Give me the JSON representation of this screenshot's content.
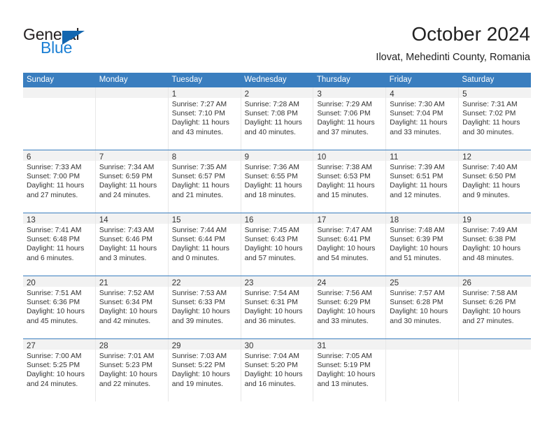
{
  "brand": {
    "name_top": "General",
    "name_bottom": "Blue",
    "accent_color": "#1367b0",
    "text_color": "#231f20"
  },
  "header": {
    "month_title": "October 2024",
    "location": "Ilovat, Mehedinti County, Romania"
  },
  "calendar": {
    "header_bg": "#3a7ebf",
    "daynum_bg": "#f2f2f2",
    "weekdays": [
      "Sunday",
      "Monday",
      "Tuesday",
      "Wednesday",
      "Thursday",
      "Friday",
      "Saturday"
    ],
    "weeks": [
      [
        {
          "day": "",
          "sunrise": "",
          "sunset": "",
          "daylight": ""
        },
        {
          "day": "",
          "sunrise": "",
          "sunset": "",
          "daylight": ""
        },
        {
          "day": "1",
          "sunrise": "Sunrise: 7:27 AM",
          "sunset": "Sunset: 7:10 PM",
          "daylight": "Daylight: 11 hours and 43 minutes."
        },
        {
          "day": "2",
          "sunrise": "Sunrise: 7:28 AM",
          "sunset": "Sunset: 7:08 PM",
          "daylight": "Daylight: 11 hours and 40 minutes."
        },
        {
          "day": "3",
          "sunrise": "Sunrise: 7:29 AM",
          "sunset": "Sunset: 7:06 PM",
          "daylight": "Daylight: 11 hours and 37 minutes."
        },
        {
          "day": "4",
          "sunrise": "Sunrise: 7:30 AM",
          "sunset": "Sunset: 7:04 PM",
          "daylight": "Daylight: 11 hours and 33 minutes."
        },
        {
          "day": "5",
          "sunrise": "Sunrise: 7:31 AM",
          "sunset": "Sunset: 7:02 PM",
          "daylight": "Daylight: 11 hours and 30 minutes."
        }
      ],
      [
        {
          "day": "6",
          "sunrise": "Sunrise: 7:33 AM",
          "sunset": "Sunset: 7:00 PM",
          "daylight": "Daylight: 11 hours and 27 minutes."
        },
        {
          "day": "7",
          "sunrise": "Sunrise: 7:34 AM",
          "sunset": "Sunset: 6:59 PM",
          "daylight": "Daylight: 11 hours and 24 minutes."
        },
        {
          "day": "8",
          "sunrise": "Sunrise: 7:35 AM",
          "sunset": "Sunset: 6:57 PM",
          "daylight": "Daylight: 11 hours and 21 minutes."
        },
        {
          "day": "9",
          "sunrise": "Sunrise: 7:36 AM",
          "sunset": "Sunset: 6:55 PM",
          "daylight": "Daylight: 11 hours and 18 minutes."
        },
        {
          "day": "10",
          "sunrise": "Sunrise: 7:38 AM",
          "sunset": "Sunset: 6:53 PM",
          "daylight": "Daylight: 11 hours and 15 minutes."
        },
        {
          "day": "11",
          "sunrise": "Sunrise: 7:39 AM",
          "sunset": "Sunset: 6:51 PM",
          "daylight": "Daylight: 11 hours and 12 minutes."
        },
        {
          "day": "12",
          "sunrise": "Sunrise: 7:40 AM",
          "sunset": "Sunset: 6:50 PM",
          "daylight": "Daylight: 11 hours and 9 minutes."
        }
      ],
      [
        {
          "day": "13",
          "sunrise": "Sunrise: 7:41 AM",
          "sunset": "Sunset: 6:48 PM",
          "daylight": "Daylight: 11 hours and 6 minutes."
        },
        {
          "day": "14",
          "sunrise": "Sunrise: 7:43 AM",
          "sunset": "Sunset: 6:46 PM",
          "daylight": "Daylight: 11 hours and 3 minutes."
        },
        {
          "day": "15",
          "sunrise": "Sunrise: 7:44 AM",
          "sunset": "Sunset: 6:44 PM",
          "daylight": "Daylight: 11 hours and 0 minutes."
        },
        {
          "day": "16",
          "sunrise": "Sunrise: 7:45 AM",
          "sunset": "Sunset: 6:43 PM",
          "daylight": "Daylight: 10 hours and 57 minutes."
        },
        {
          "day": "17",
          "sunrise": "Sunrise: 7:47 AM",
          "sunset": "Sunset: 6:41 PM",
          "daylight": "Daylight: 10 hours and 54 minutes."
        },
        {
          "day": "18",
          "sunrise": "Sunrise: 7:48 AM",
          "sunset": "Sunset: 6:39 PM",
          "daylight": "Daylight: 10 hours and 51 minutes."
        },
        {
          "day": "19",
          "sunrise": "Sunrise: 7:49 AM",
          "sunset": "Sunset: 6:38 PM",
          "daylight": "Daylight: 10 hours and 48 minutes."
        }
      ],
      [
        {
          "day": "20",
          "sunrise": "Sunrise: 7:51 AM",
          "sunset": "Sunset: 6:36 PM",
          "daylight": "Daylight: 10 hours and 45 minutes."
        },
        {
          "day": "21",
          "sunrise": "Sunrise: 7:52 AM",
          "sunset": "Sunset: 6:34 PM",
          "daylight": "Daylight: 10 hours and 42 minutes."
        },
        {
          "day": "22",
          "sunrise": "Sunrise: 7:53 AM",
          "sunset": "Sunset: 6:33 PM",
          "daylight": "Daylight: 10 hours and 39 minutes."
        },
        {
          "day": "23",
          "sunrise": "Sunrise: 7:54 AM",
          "sunset": "Sunset: 6:31 PM",
          "daylight": "Daylight: 10 hours and 36 minutes."
        },
        {
          "day": "24",
          "sunrise": "Sunrise: 7:56 AM",
          "sunset": "Sunset: 6:29 PM",
          "daylight": "Daylight: 10 hours and 33 minutes."
        },
        {
          "day": "25",
          "sunrise": "Sunrise: 7:57 AM",
          "sunset": "Sunset: 6:28 PM",
          "daylight": "Daylight: 10 hours and 30 minutes."
        },
        {
          "day": "26",
          "sunrise": "Sunrise: 7:58 AM",
          "sunset": "Sunset: 6:26 PM",
          "daylight": "Daylight: 10 hours and 27 minutes."
        }
      ],
      [
        {
          "day": "27",
          "sunrise": "Sunrise: 7:00 AM",
          "sunset": "Sunset: 5:25 PM",
          "daylight": "Daylight: 10 hours and 24 minutes."
        },
        {
          "day": "28",
          "sunrise": "Sunrise: 7:01 AM",
          "sunset": "Sunset: 5:23 PM",
          "daylight": "Daylight: 10 hours and 22 minutes."
        },
        {
          "day": "29",
          "sunrise": "Sunrise: 7:03 AM",
          "sunset": "Sunset: 5:22 PM",
          "daylight": "Daylight: 10 hours and 19 minutes."
        },
        {
          "day": "30",
          "sunrise": "Sunrise: 7:04 AM",
          "sunset": "Sunset: 5:20 PM",
          "daylight": "Daylight: 10 hours and 16 minutes."
        },
        {
          "day": "31",
          "sunrise": "Sunrise: 7:05 AM",
          "sunset": "Sunset: 5:19 PM",
          "daylight": "Daylight: 10 hours and 13 minutes."
        },
        {
          "day": "",
          "sunrise": "",
          "sunset": "",
          "daylight": ""
        },
        {
          "day": "",
          "sunrise": "",
          "sunset": "",
          "daylight": ""
        }
      ]
    ]
  }
}
